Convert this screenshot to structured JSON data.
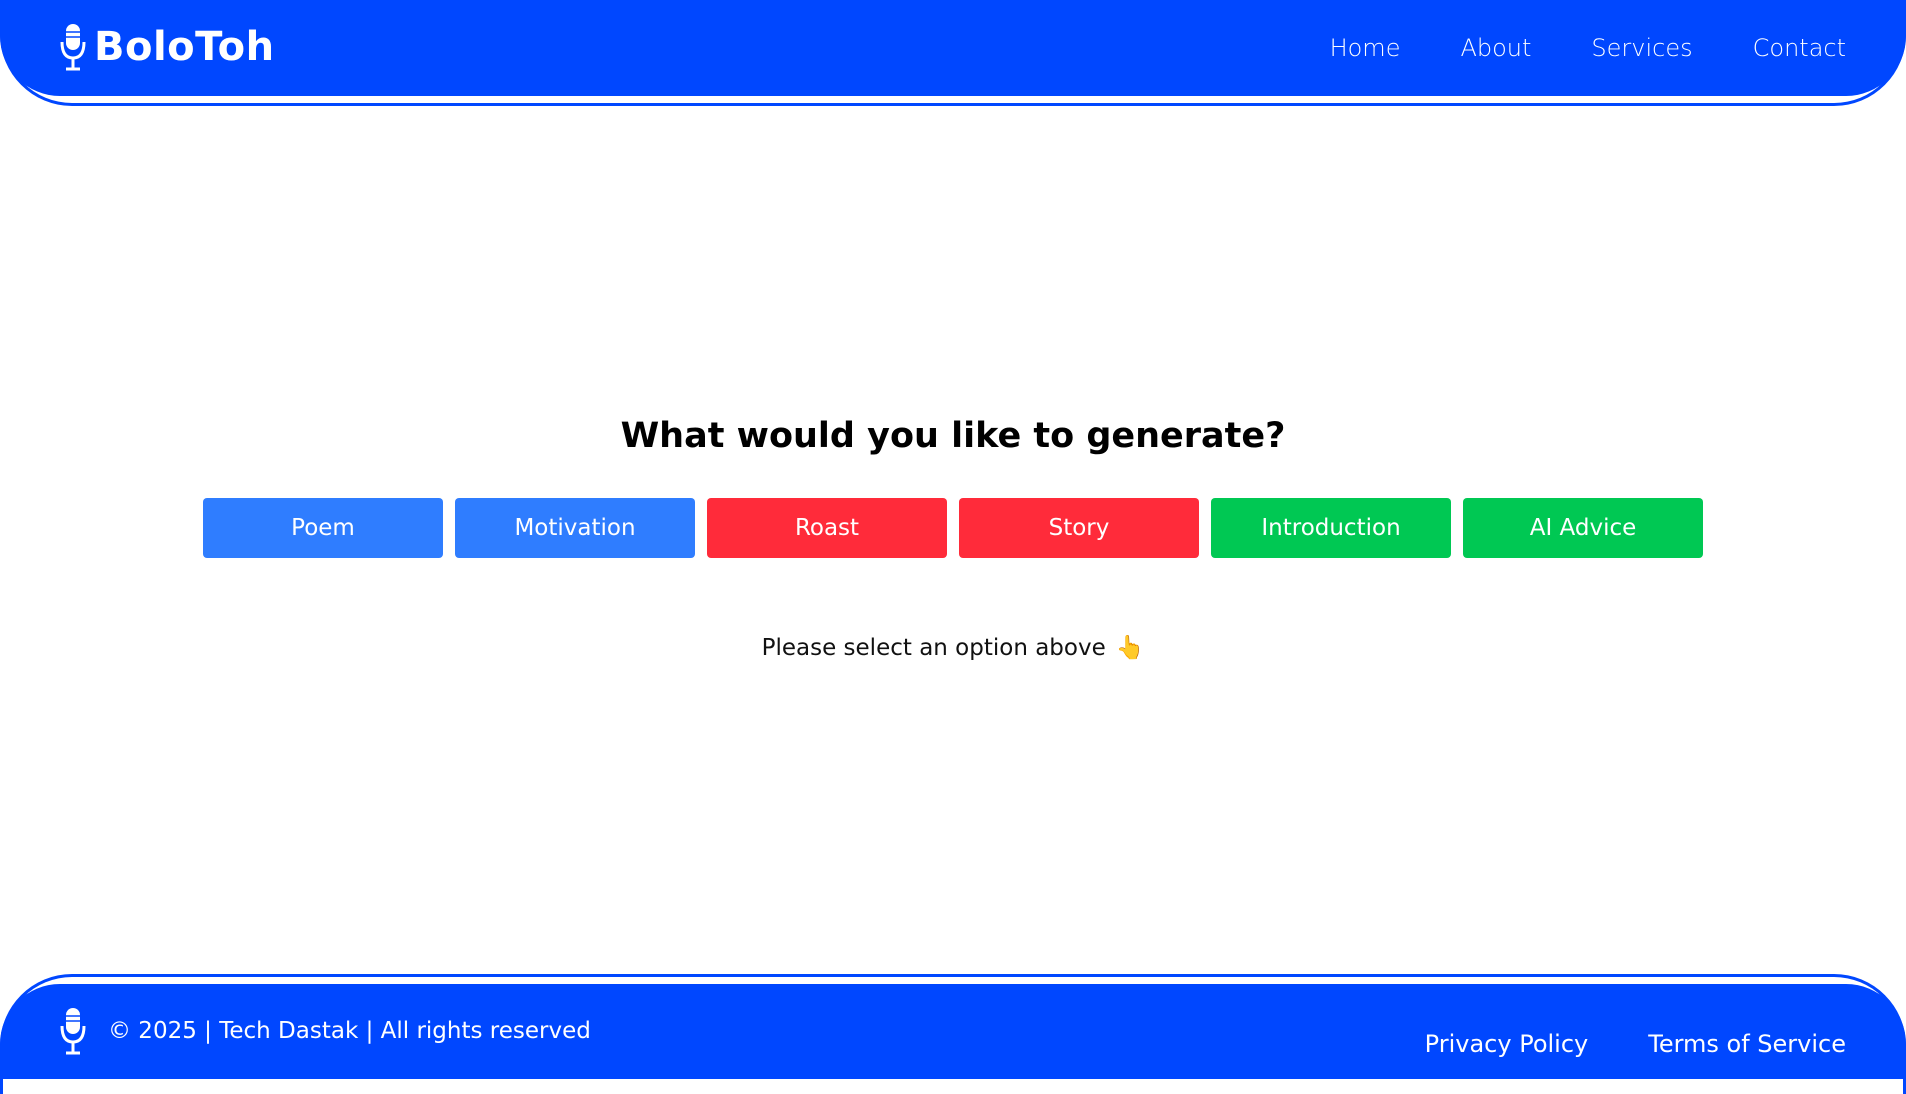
{
  "header": {
    "brand_name": "BoloToh",
    "brand_icon": "microphone-icon",
    "nav": [
      {
        "label": "Home"
      },
      {
        "label": "About"
      },
      {
        "label": "Services"
      },
      {
        "label": "Contact"
      }
    ]
  },
  "main": {
    "heading": "What would you like to generate?",
    "options": [
      {
        "label": "Poem",
        "color": "#2f7dff"
      },
      {
        "label": "Motivation",
        "color": "#2f7dff"
      },
      {
        "label": "Roast",
        "color": "#ff2b3a"
      },
      {
        "label": "Story",
        "color": "#ff2b3a"
      },
      {
        "label": "Introduction",
        "color": "#00c853"
      },
      {
        "label": "AI Advice",
        "color": "#00c853"
      }
    ],
    "hint": "Please select an option above",
    "hint_emoji": "👆"
  },
  "footer": {
    "icon": "microphone-icon",
    "copyright": "© 2025 | Tech Dastak | All rights reserved",
    "links": [
      {
        "label": "Privacy Policy"
      },
      {
        "label": "Terms of Service"
      }
    ]
  },
  "colors": {
    "primary": "#0047ff",
    "blue_button": "#2f7dff",
    "red_button": "#ff2b3a",
    "green_button": "#00c853"
  }
}
